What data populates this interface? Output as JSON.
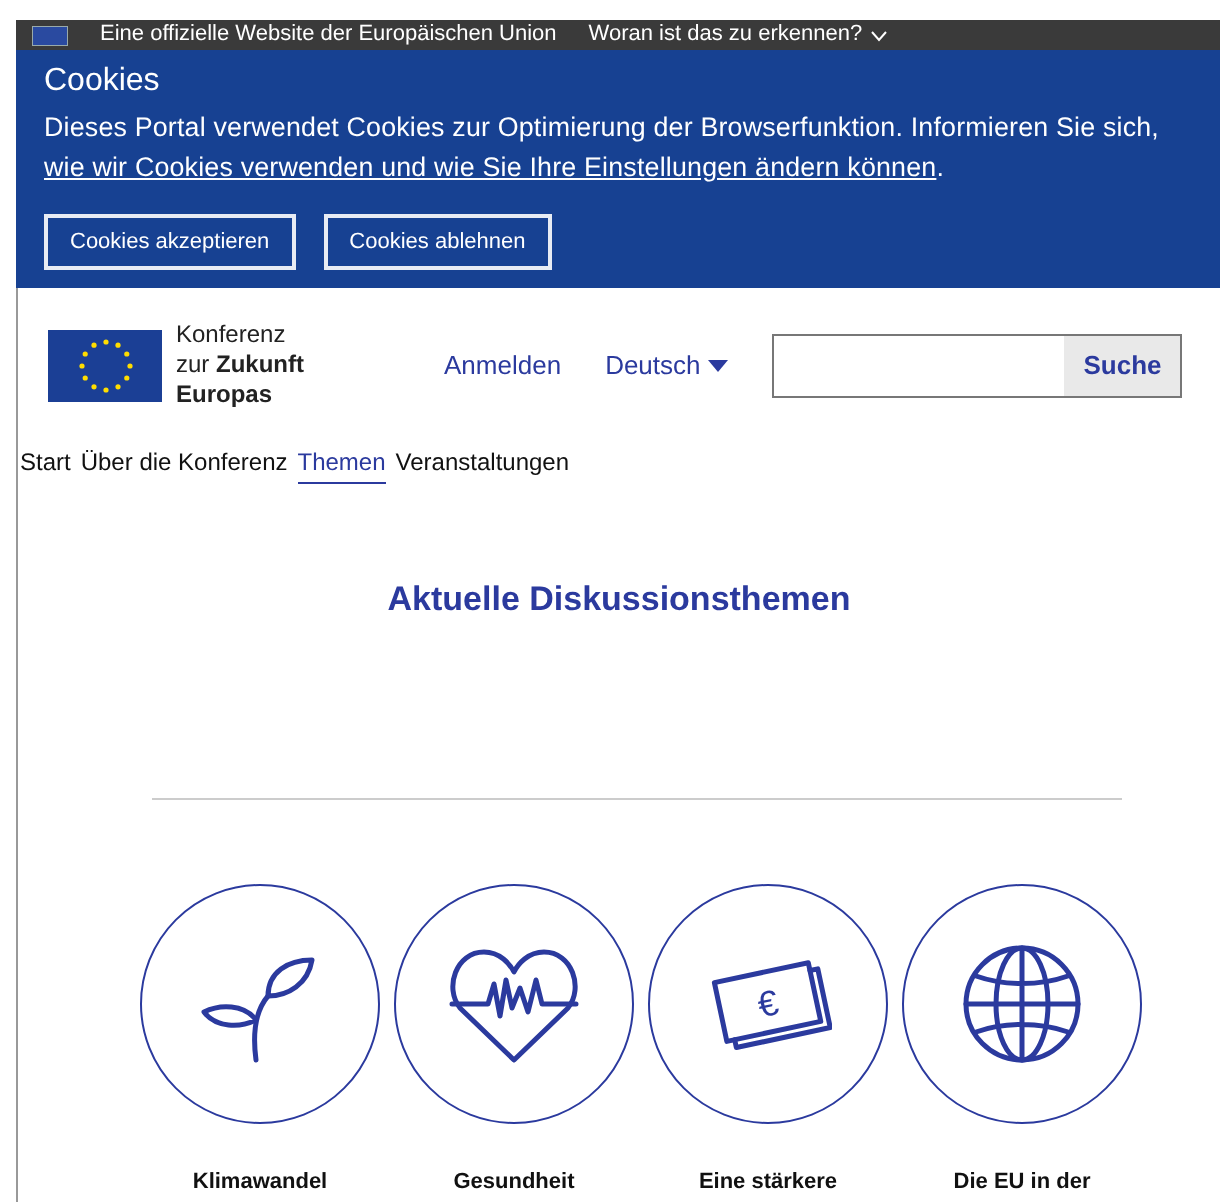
{
  "top_bar": {
    "official": "Eine offizielle Website der Europäischen Union",
    "question": "Woran ist das zu erkennen?"
  },
  "cookies": {
    "title": "Cookies",
    "text": "Dieses Portal verwendet Cookies zur Optimierung der Browserfunktion. Informieren Sie sich,",
    "link": "wie wir Cookies verwenden und wie Sie Ihre Einstellungen ändern können",
    "after": ".",
    "buttons": [
      "Cookies akzeptieren",
      "Cookies ablehnen"
    ]
  },
  "header": {
    "logo_lines": [
      "Konferenz",
      "zur **Zukunft**",
      "**Europas**"
    ],
    "login": "Anmelden",
    "language": "Deutsch",
    "search_button": "Suche"
  },
  "nav": [
    {
      "label": "Start",
      "selected": false
    },
    {
      "label": "Über die Konferenz",
      "selected": false
    },
    {
      "label": "Themen",
      "selected": true
    },
    {
      "label": "Veranstaltungen",
      "selected": false
    }
  ],
  "heading": "Aktuelle Diskussionsthemen",
  "topics": [
    {
      "kind": "plant",
      "label": "Klimawandel"
    },
    {
      "kind": "heart",
      "label": "Gesundheit"
    },
    {
      "kind": "money",
      "label": "Eine stärkere",
      "icon_text": "€"
    },
    {
      "kind": "globe",
      "label": "Die EU in der"
    }
  ]
}
